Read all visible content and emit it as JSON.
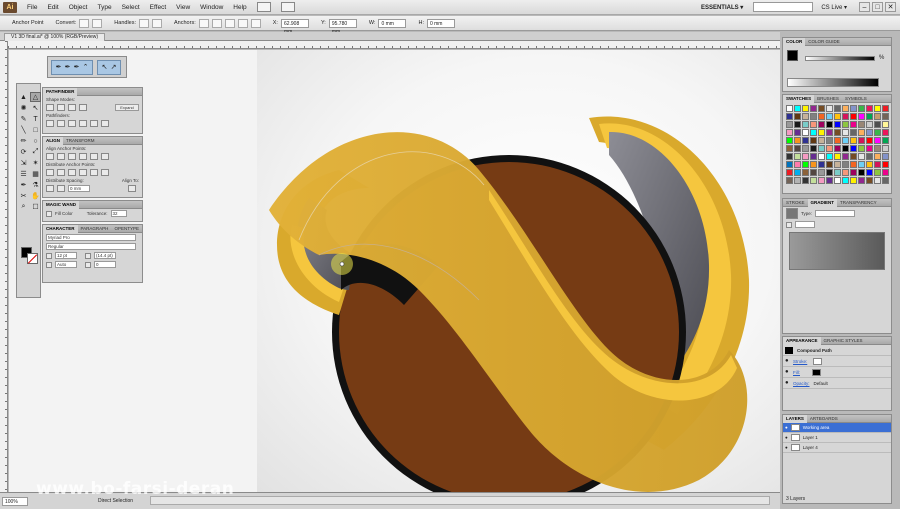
{
  "menubar": {
    "logo": "Ai",
    "items": [
      "File",
      "Edit",
      "Object",
      "Type",
      "Select",
      "Effect",
      "View",
      "Window",
      "Help"
    ],
    "workspace": "ESSENTIALS ▾",
    "cs_live": "CS Live ▾",
    "window_buttons": [
      "–",
      "□",
      "✕"
    ]
  },
  "controlbar": {
    "anchor_point": "Anchor Point",
    "convert": "Convert:",
    "handles": "Handles:",
    "anchors": "Anchors:",
    "x_value": "62.908 mm",
    "y_value": "95.780 mm",
    "w_value": "0 mm",
    "h_value": "0 mm"
  },
  "document": {
    "tab_title": "V1 3D final.ai* @ 100% (RGB/Preview)"
  },
  "tools": {
    "glyphs": [
      "▲",
      "△",
      "✺",
      "↖",
      "✎",
      "T",
      "╲",
      "□",
      "✏",
      "○",
      "⟳",
      "⤢",
      "⇲",
      "✶",
      "☰",
      "▦",
      "✒",
      "⚗",
      "✂",
      "✋",
      "⌕",
      "☐"
    ]
  },
  "pathfinder": {
    "tabs": [
      "PATHFINDER"
    ],
    "shape_modes": "Shape Modes:",
    "expand": "Expand",
    "pathfinders": "Pathfinders:"
  },
  "align": {
    "tabs": [
      "ALIGN",
      "TRANSFORM"
    ],
    "align_anchor": "Align Anchor Points:",
    "distribute_anchor": "Distribute Anchor Points:",
    "distribute_spacing": "Distribute Spacing:",
    "align_to": "Align To:",
    "spacing_value": "0 mm"
  },
  "magic_wand": {
    "tabs": [
      "MAGIC WAND"
    ],
    "fill_color": "Fill Color",
    "tolerance": "Tolerance:",
    "tolerance_value": "32"
  },
  "character": {
    "tabs": [
      "CHARACTER",
      "PARAGRAPH",
      "OPENTYPE"
    ],
    "font": "Myriad Pro",
    "style": "Regular",
    "size": "12 pt",
    "leading": "(14.4 pt)",
    "kerning": "Auto",
    "tracking": "0"
  },
  "right_panels": {
    "color_tabs": [
      "COLOR",
      "COLOR GUIDE"
    ],
    "color_percent": "%",
    "swatches_tabs": [
      "SWATCHES",
      "BRUSHES",
      "SYMBOLS"
    ],
    "gradient_tabs": [
      "STROKE",
      "GRADIENT",
      "TRANSPARENCY"
    ],
    "gradient_type_label": "Type:",
    "appearance_tabs": [
      "APPEARANCE",
      "GRAPHIC STYLES"
    ],
    "compound_path": "Compound Path",
    "stroke": "Stroke:",
    "fill": "Fill:",
    "opacity": "Opacity:",
    "opacity_value": "Default",
    "layers_tabs": [
      "LAYERS",
      "ARTBOARDS"
    ],
    "layers": [
      {
        "name": "Working area",
        "selected": true
      },
      {
        "name": "Layer 1",
        "selected": false
      },
      {
        "name": "Layer 4",
        "selected": false
      }
    ],
    "layers_count": "3 Layers"
  },
  "statusbar": {
    "zoom": "100%",
    "status_text": "Direct Selection",
    "watermark": "www.bo-farsi-deran"
  },
  "colors": {
    "sphere": "#763b14",
    "ribbon": "#d9a92c",
    "ribbon_highlight": "#f5c63e",
    "inner_grey": "#6a6a73",
    "outline": "#111111"
  }
}
